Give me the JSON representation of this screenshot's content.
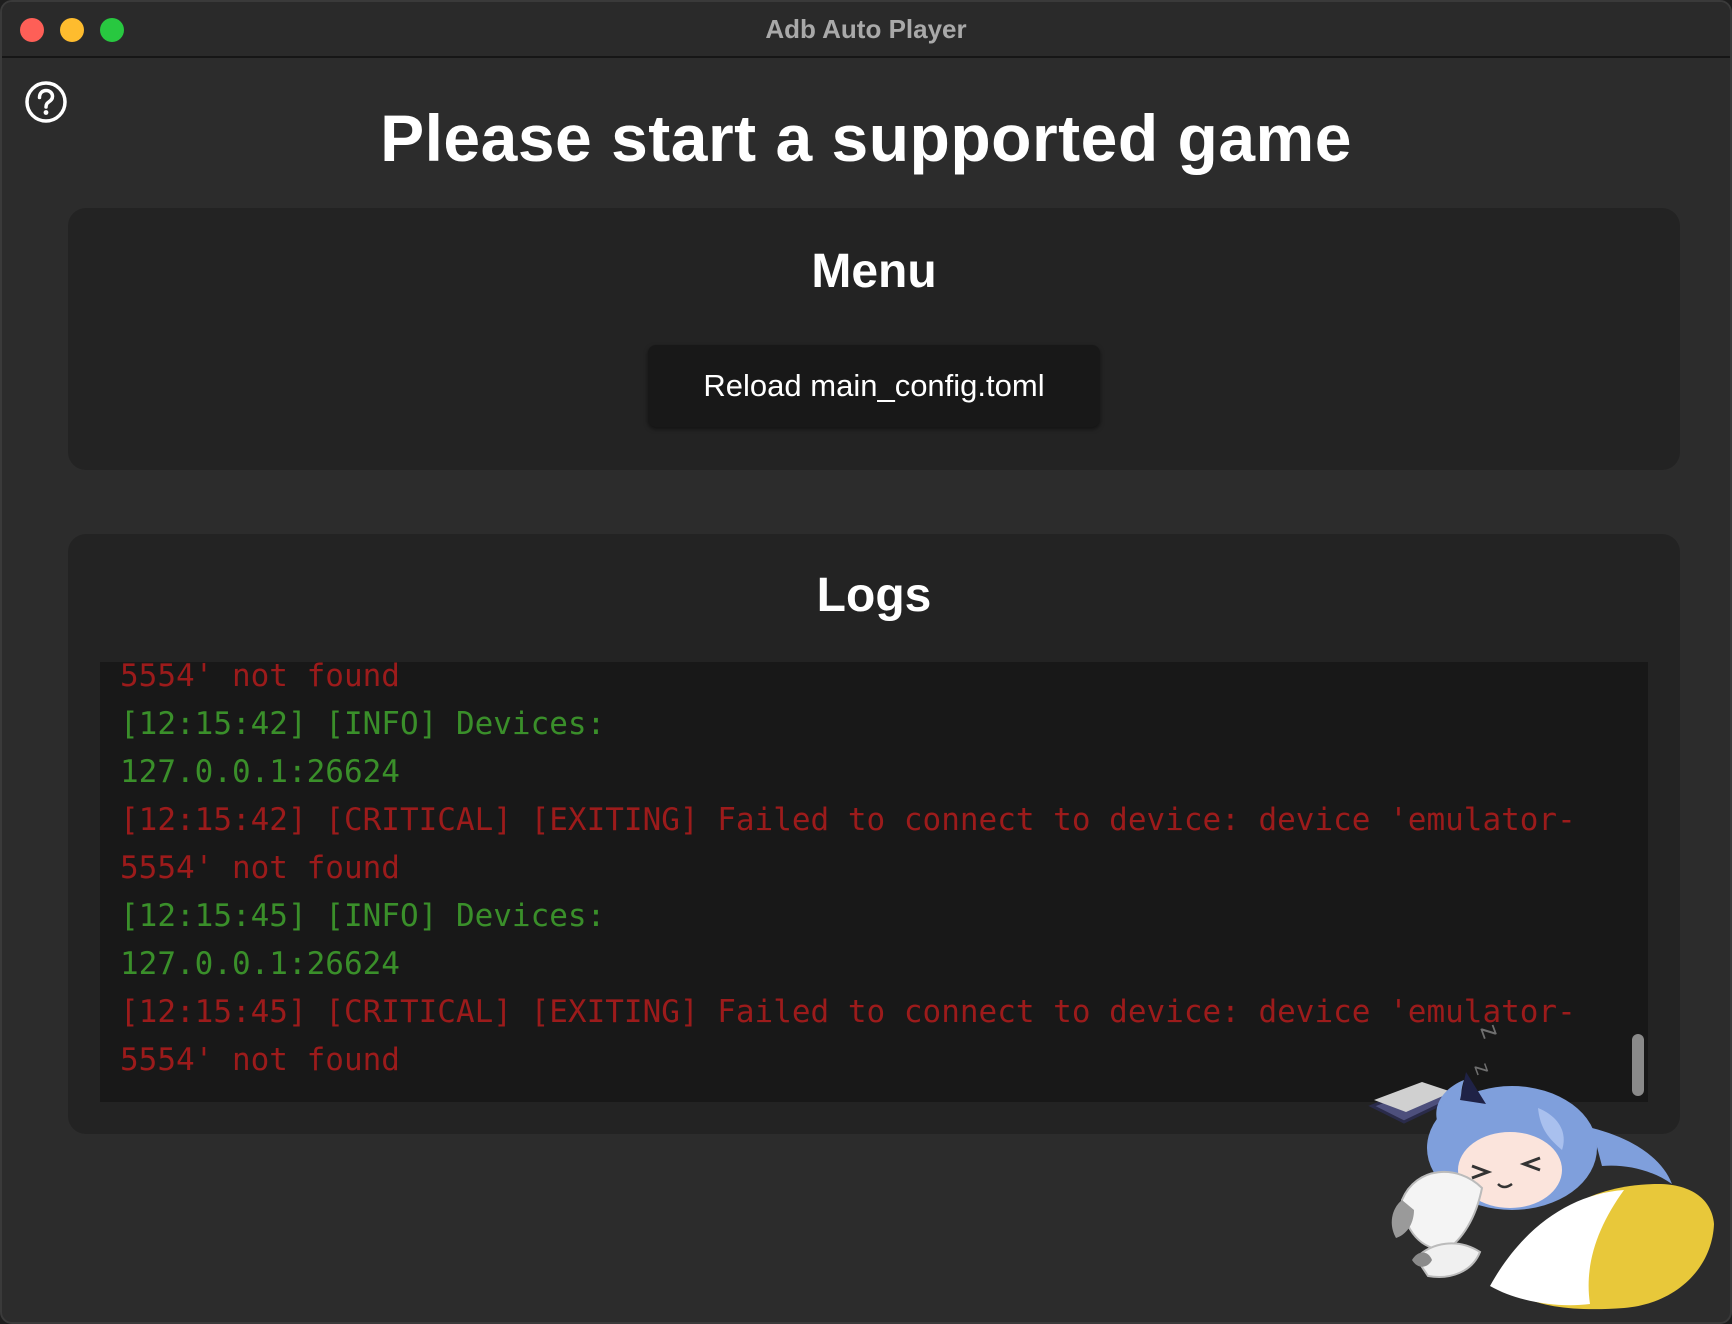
{
  "window": {
    "title": "Adb Auto Player"
  },
  "help": {
    "icon": "question-circle-icon"
  },
  "page": {
    "title": "Please start a supported game"
  },
  "menu": {
    "title": "Menu",
    "reload_label": "Reload main_config.toml"
  },
  "logs": {
    "title": "Logs",
    "lines": [
      {
        "level": "critical",
        "text": "5554' not found"
      },
      {
        "level": "info",
        "text": "[12:15:42] [INFO] Devices:"
      },
      {
        "level": "info",
        "text": "127.0.0.1:26624"
      },
      {
        "level": "critical",
        "text": "[12:15:42] [CRITICAL] [EXITING] Failed to connect to device: device 'emulator-"
      },
      {
        "level": "critical",
        "text": "5554' not found"
      },
      {
        "level": "info",
        "text": "[12:15:45] [INFO] Devices:"
      },
      {
        "level": "info",
        "text": "127.0.0.1:26624"
      },
      {
        "level": "critical",
        "text": "[12:15:45] [CRITICAL] [EXITING] Failed to connect to device: device 'emulator-"
      },
      {
        "level": "critical",
        "text": "5554' not found"
      }
    ]
  },
  "colors": {
    "info": "#3a8f2a",
    "critical": "#9c1b1b",
    "background": "#2c2c2c",
    "card": "#232323"
  },
  "decoration": {
    "mascot": "sleeping-anime-girl-icon"
  }
}
